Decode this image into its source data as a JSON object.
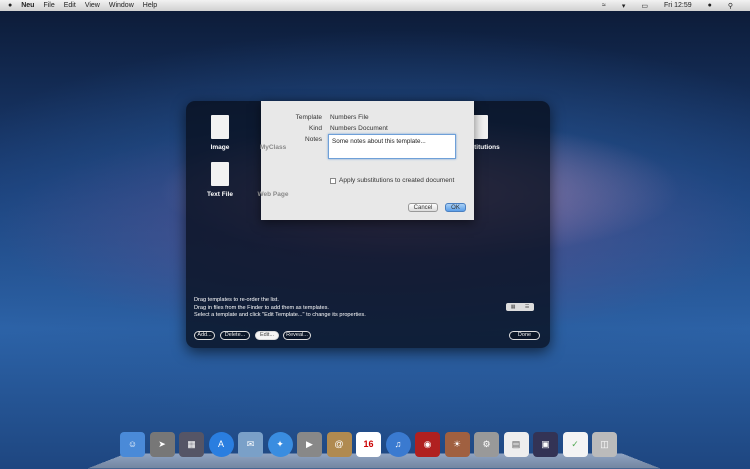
{
  "menubar": {
    "apple": "",
    "items": [
      "Neu",
      "File",
      "Edit",
      "View",
      "Window",
      "Help"
    ],
    "clock": "Fri 12:59"
  },
  "templates": [
    {
      "label": "Image"
    },
    {
      "label": "MyClass"
    },
    {
      "label": "Substitutions"
    },
    {
      "label": "Text File"
    },
    {
      "label": "Web Page"
    }
  ],
  "sheet": {
    "template_label": "Template",
    "template_value": "Numbers File",
    "kind_label": "Kind",
    "kind_value": "Numbers Document",
    "notes_label": "Notes",
    "notes_value": "Some notes about this template...",
    "checkbox_label": "Apply substitutions to created document",
    "checkbox_checked": false,
    "cancel": "Cancel",
    "ok": "OK"
  },
  "help": [
    "Drag templates to re-order the list.",
    "Drag in files from the Finder to add them as templates.",
    "Select a template and click \"Edit Template...\" to change its properties."
  ],
  "buttons": {
    "add": "Add...",
    "delete": "Delete...",
    "edit": "Edit...",
    "reveal": "Reveal...",
    "done": "Done"
  },
  "dock": {
    "calendar_day": "16",
    "items": [
      "finder",
      "launchpad",
      "mission-control",
      "app-store",
      "mail",
      "safari",
      "facetime",
      "contacts",
      "calendar",
      "itunes",
      "photo-booth",
      "iphoto",
      "system-preferences",
      "preview",
      "screen",
      "textedit",
      "trash"
    ]
  }
}
